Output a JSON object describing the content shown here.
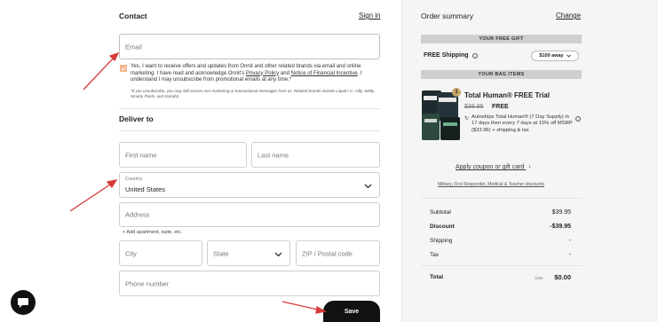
{
  "contact": {
    "title": "Contact",
    "sign_in": "Sign in",
    "email_placeholder": "Email",
    "consent_text_1": "Yes, I want to receive offers and updates from Onnit and other related brands via email and online marketing. I have read and acknowledge Onnit's ",
    "privacy_link": "Privacy Policy",
    "consent_text_2": " and ",
    "notice_link": "Notice of Financial Incentive",
    "consent_text_3": ". I understand I may unsubscribe from promotional emails at any time.*",
    "fineprint": "*If you unsubscribe, you may still receive non-marketing or transactional messages from us. Related brands include Liquid I.V., Olly, Welly, Smarty Pants, and Nutrafol."
  },
  "deliver": {
    "title": "Deliver to",
    "first_name_placeholder": "First name",
    "last_name_placeholder": "Last name",
    "country_label": "Country",
    "country_value": "United States",
    "address_placeholder": "Address",
    "add_apartment": "+ Add apartment, suite, etc.",
    "city_placeholder": "City",
    "state_placeholder": "State",
    "zip_placeholder": "ZIP / Postal code",
    "phone_placeholder": "Phone number",
    "save_label": "Save"
  },
  "summary": {
    "title": "Order summary",
    "change": "Change",
    "free_gift_bar": "YOUR FREE GIFT",
    "free_shipping": "FREE Shipping",
    "away_chip": "$100 away",
    "bag_items_bar": "YOUR BAG ITEMS",
    "product": {
      "badge": "1",
      "name": "Total Human® FREE Trial",
      "original_price": "$39.95",
      "price": "FREE",
      "autoship_text": "Autoships Total Human® (7 Day Supply) in 17 days then every 7 days at 15% off MSRP ($33.96) + shipping & tax"
    },
    "coupon": "Apply coupon or gift card",
    "military": "Military, First Responder, Medical & Teacher discounts",
    "rows": [
      {
        "label": "Subtotal",
        "value": "$39.95",
        "bold": false
      },
      {
        "label": "Discount",
        "value": "-$39.95",
        "bold": true
      },
      {
        "label": "Shipping",
        "value": "-",
        "bold": false
      },
      {
        "label": "Tax",
        "value": "-",
        "bold": false
      }
    ],
    "total_label": "Total",
    "total_currency": "USD",
    "total_value": "$0.00"
  },
  "colors": {
    "checkbox": "#f0b48a",
    "arrow": "#d63b3b",
    "button": "#111111",
    "panel_bg": "#f5f5f5"
  }
}
